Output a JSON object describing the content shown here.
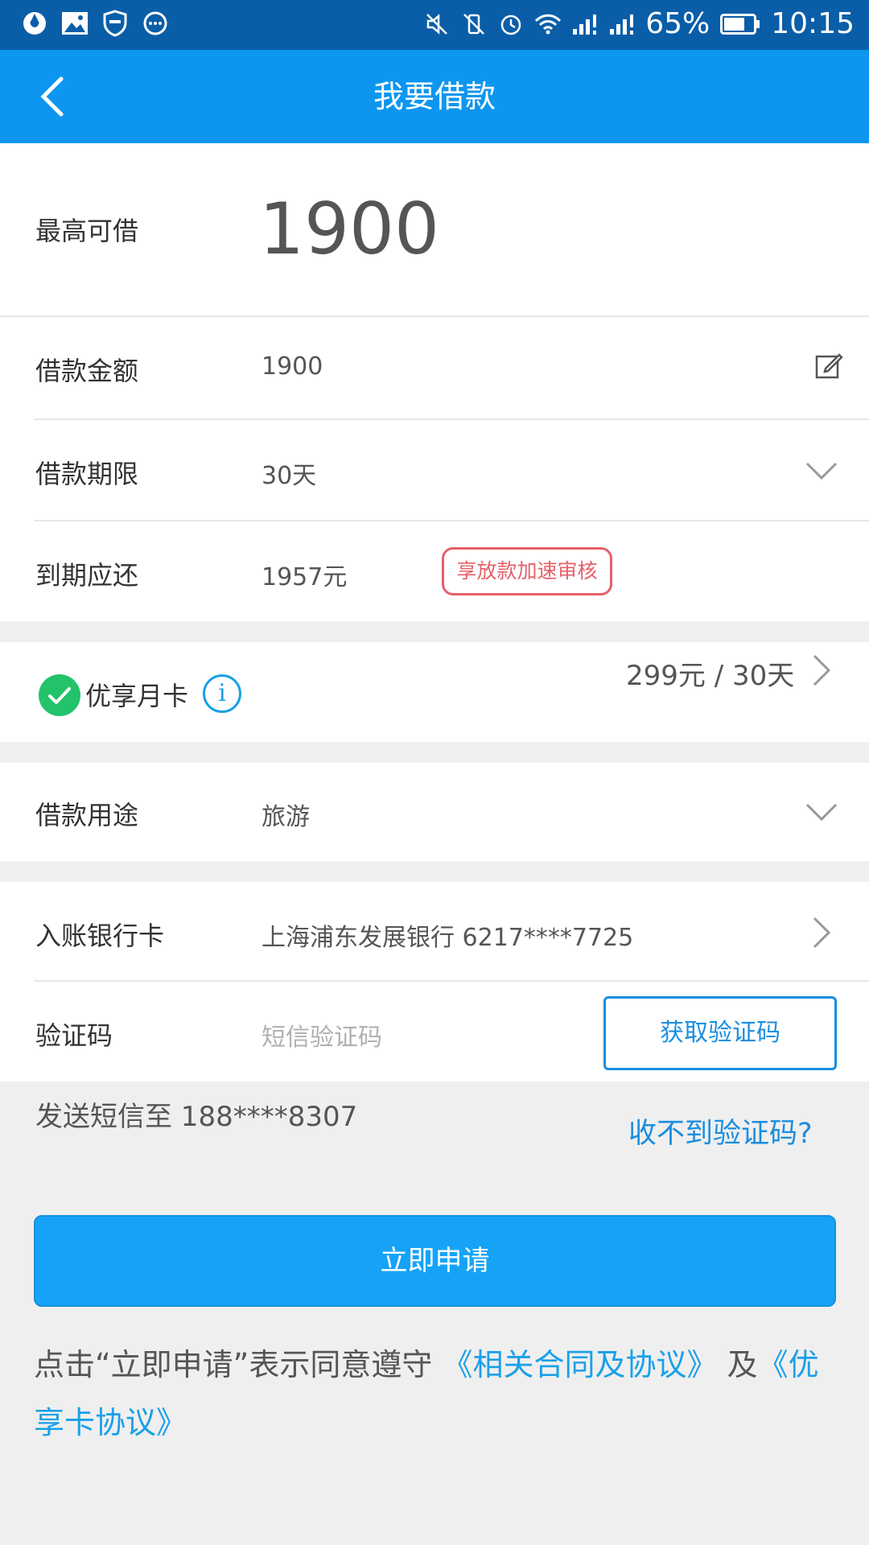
{
  "status_bar": {
    "battery": "65%",
    "time": "10:15"
  },
  "header": {
    "title": "我要借款"
  },
  "max_borrow": {
    "label": "最高可借",
    "value": "1900"
  },
  "loan_amount": {
    "label": "借款金额",
    "value": "1900"
  },
  "loan_term": {
    "label": "借款期限",
    "value": "30天"
  },
  "due_repay": {
    "label": "到期应还",
    "value": "1957元",
    "tag": "享放款加速审核"
  },
  "monthly_card": {
    "label": "优享月卡",
    "price": "299元 / 30天"
  },
  "loan_purpose": {
    "label": "借款用途",
    "value": "旅游"
  },
  "bank_card": {
    "label": "入账银行卡",
    "value": "上海浦东发展银行 6217****7725"
  },
  "verification": {
    "label": "验证码",
    "placeholder": "短信验证码",
    "button": "获取验证码"
  },
  "sms_note": "发送短信至 188****8307",
  "no_code_link": "收不到验证码?",
  "apply_button": "立即申请",
  "agreement": {
    "prefix": "点击“立即申请”表示同意遵守",
    "link1": "《相关合同及协议》",
    "middle": "及",
    "link2": "《优享卡协议》"
  },
  "colors": {
    "status_bar": "#0a5ea8",
    "title_bar": "#0c96f0",
    "primary_button": "#16a3f7",
    "link": "#1aa0e8",
    "tag": "#e5606a",
    "check": "#23c36a"
  }
}
